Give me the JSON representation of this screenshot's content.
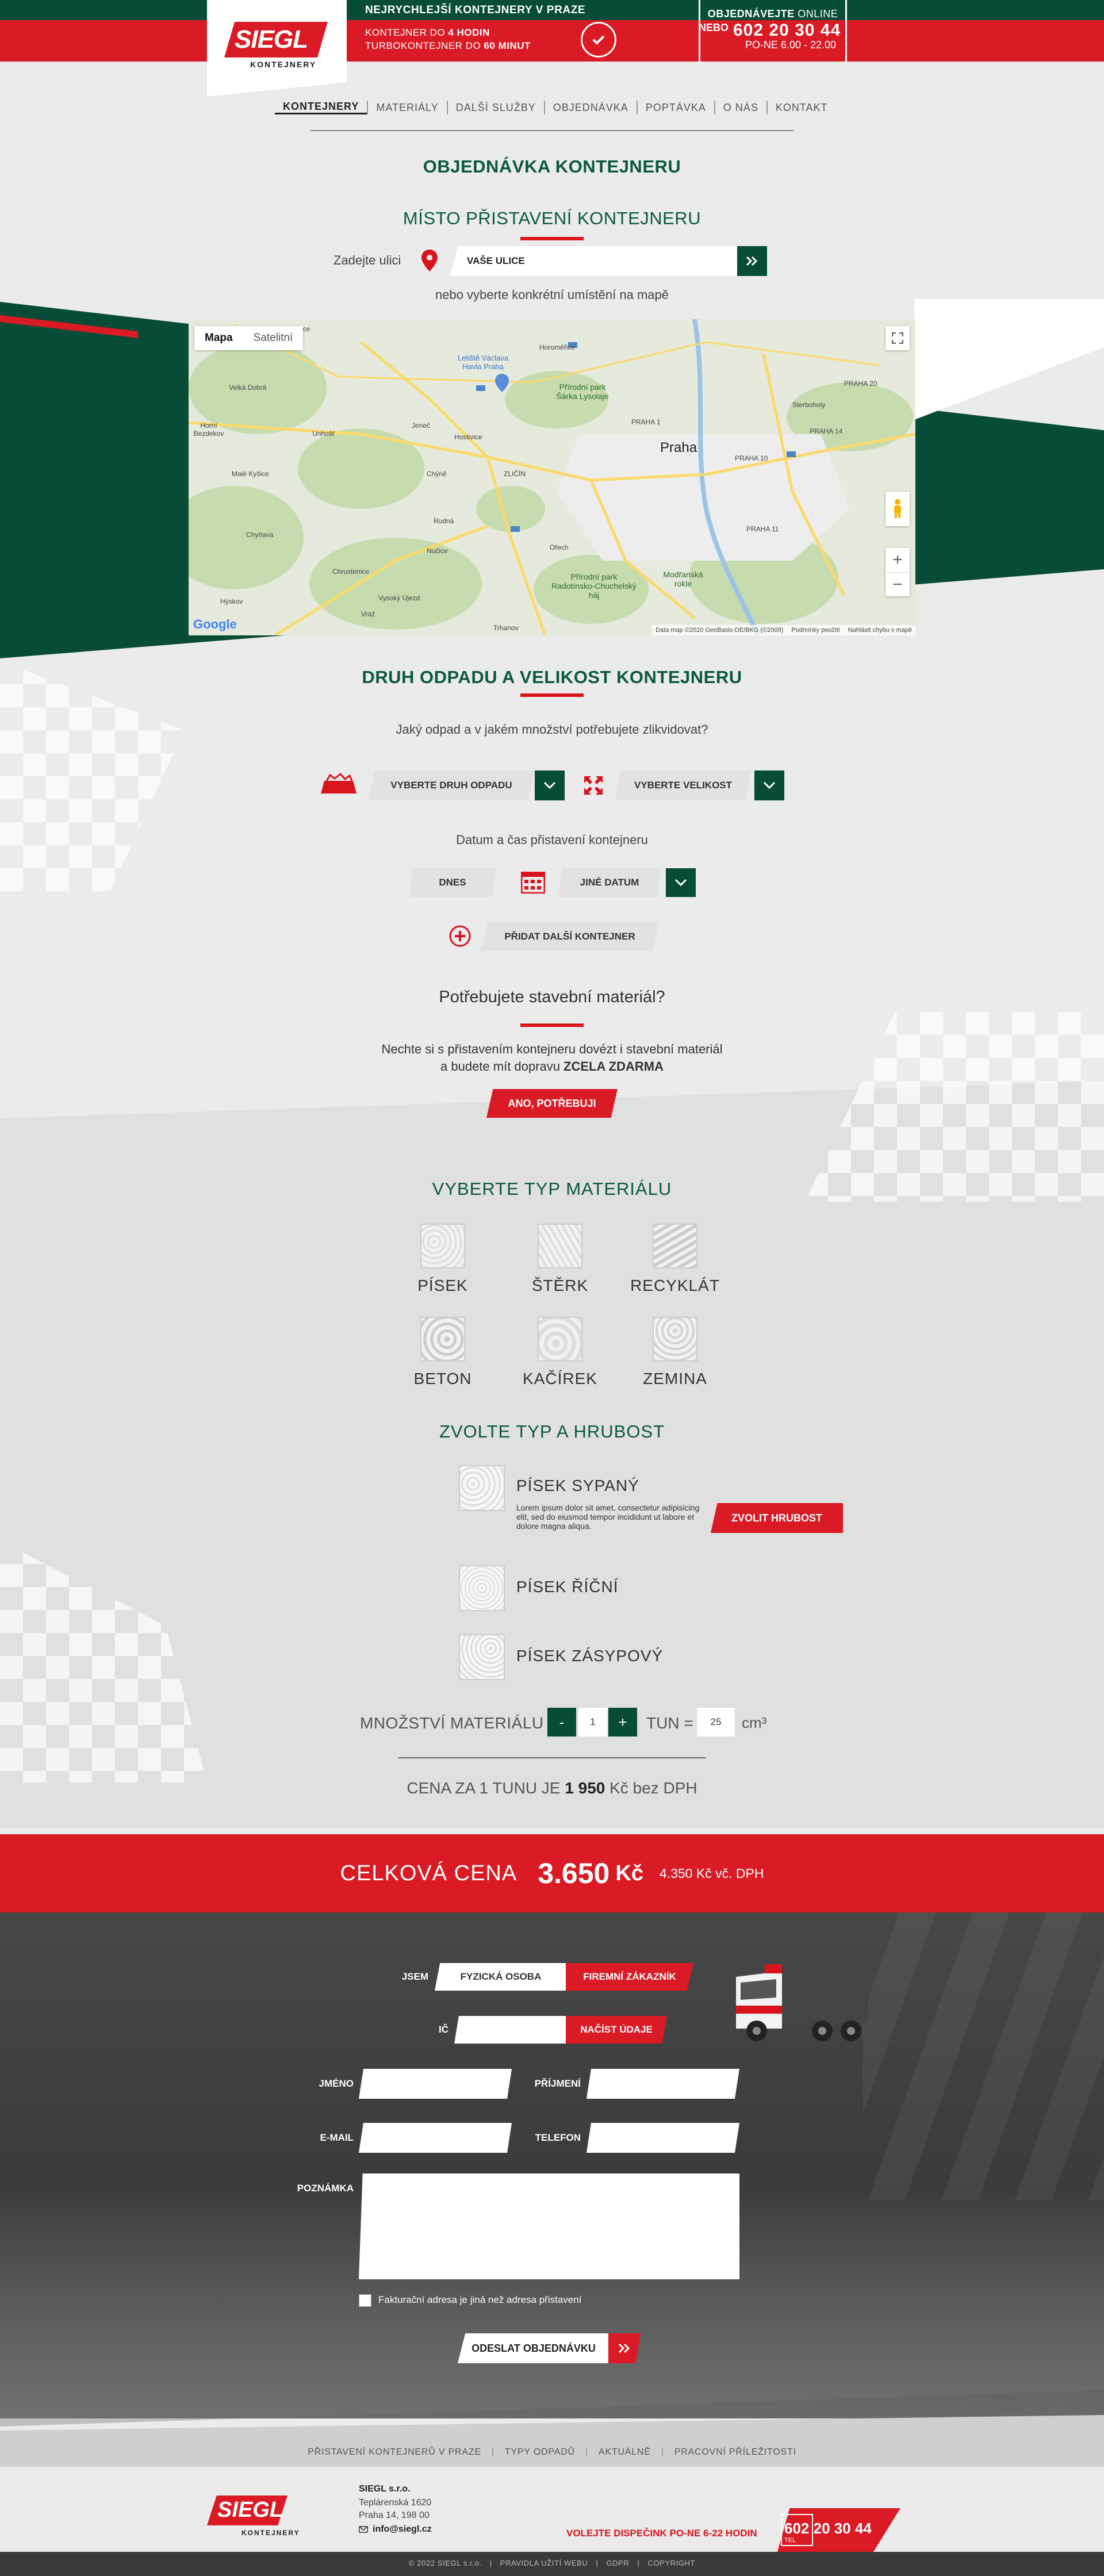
{
  "header": {
    "tagline": "NEJRYCHLEJŠÍ KONTEJNERY V PRAZE",
    "promo_line1_a": "KONTEJNER DO ",
    "promo_line1_b": "4 HODIN",
    "promo_line2_a": "TURBOKONTEJNER DO ",
    "promo_line2_b": "60 MINUT",
    "order_online_a": "OBJEDNÁVEJTE",
    "order_online_b": " ONLINE",
    "or": "NEBO",
    "phone": "602 20 30 44",
    "hours": "PO-NE 6.00 - 22.00",
    "logo_text": "SIEGL",
    "logo_sub": "KONTEJNERY"
  },
  "nav": {
    "items": [
      "KONTEJNERY",
      "MATERIÁLY",
      "DALŠÍ SLUŽBY",
      "OBJEDNÁVKA",
      "POPTÁVKA",
      "O NÁS",
      "KONTAKT"
    ]
  },
  "order": {
    "title": "OBJEDNÁVKA KONTEJNERU",
    "place_title": "MÍSTO PŘISTAVENÍ KONTEJNERU",
    "street_label": "Zadejte ulici",
    "street_placeholder": "VAŠE ULICE",
    "map_hint": "nebo vyberte konkrétní umístění na mapě"
  },
  "map": {
    "tab_map": "Mapa",
    "tab_sat": "Satelitní",
    "places": [
      "Lidice",
      "Velká Dobrá",
      "Horní Bezdekov",
      "Malé Kyšice",
      "Chyňava",
      "Unhošť",
      "Jeneč",
      "Hostivice",
      "Chýně",
      "Rudná",
      "Nučice",
      "Chrustenice",
      "Vysoký Újezd",
      "Vráž",
      "Hýskov",
      "Letiště Václava Havla Praha",
      "Horoměřice",
      "Přírodní park Šárka Lysolaje",
      "Praha",
      "PRAHA 1",
      "ZLIČÍN",
      "Ořech",
      "Přírodní park Radotínsko-Chuchelský háj",
      "Modřanská rokle",
      "Sterboholy",
      "PRAHA 20",
      "PRAHA 14",
      "PRAHA 10",
      "PRAHA 11",
      "Trhanov"
    ],
    "copyright": "Data map ©2020 GeoBasis-DE/BKG (©2009)",
    "terms": "Podmínky použití",
    "report": "Nahlásit chybu v mapě",
    "google": "Google"
  },
  "waste": {
    "title": "DRUH ODPADU A VELIKOST KONTEJNERU",
    "question": "Jaký odpad a v jakém množství potřebujete zlikvidovat?",
    "type_btn": "VYBERTE DRUH ODPADU",
    "size_btn": "VYBERTE VELIKOST",
    "date_label": "Datum a čas přistavení kontejneru",
    "today_btn": "DNES",
    "other_date_btn": "JINÉ DATUM",
    "add_btn": "PŘIDAT DALŠÍ KONTEJNER"
  },
  "material_offer": {
    "title": "Potřebujete stavební materiál?",
    "text1": "Nechte si s přistavením kontejneru dovézt i stavební materiál",
    "text2": "a budete mít dopravu ",
    "text2_b": "ZCELA ZDARMA",
    "yes_btn": "ANO, POTŘEBUJI"
  },
  "materials": {
    "title": "VYBERTE TYP MATERIÁLU",
    "items": [
      "PÍSEK",
      "ŠTĚRK",
      "RECYKLÁT",
      "BETON",
      "KAČÍREK",
      "ZEMINA"
    ]
  },
  "grain": {
    "title": "ZVOLTE TYP A HRUBOST",
    "items": [
      {
        "name": "PÍSEK SYPANÝ",
        "desc": "Lorem ipsum dolor sit amet, consectetur adipisicing elit, sed do eiusmod tempor incididunt ut labore et dolore magna aliqua."
      },
      {
        "name": "PÍSEK ŘÍČNÍ",
        "desc": ""
      },
      {
        "name": "PÍSEK ZÁSYPOVÝ",
        "desc": ""
      }
    ],
    "choose_btn": "ZVOLIT HRUBOST"
  },
  "quantity": {
    "label": "MNOŽSTVÍ MATERIÁLU",
    "minus": "-",
    "value": "1",
    "plus": "+",
    "unit_a": "TUN =",
    "volume": "25",
    "unit_b": "cm³",
    "price_a": "CENA ZA 1 TUNU JE ",
    "price_b": "1 950",
    "price_c": " Kč bez DPH"
  },
  "total": {
    "label": "CELKOVÁ CENA",
    "amount": "3.650",
    "currency": "Kč",
    "vat": "4.350 Kč vč. DPH"
  },
  "form": {
    "jsem": "JSEM",
    "person": "FYZICKÁ OSOBA",
    "company": "FIREMNÍ ZÁKAZNÍK",
    "ic": "IČ",
    "load_btn": "NAČÍST ÚDAJE",
    "name": "JMÉNO",
    "surname": "PŘÍJMENÍ",
    "email": "E-MAIL",
    "phone": "TELEFON",
    "note": "POZNÁMKA",
    "billing": "Fakturační adresa je jiná než adresa přistavení",
    "submit": "ODESLAT OBJEDNÁVKU"
  },
  "footer": {
    "links": [
      "PŘISTAVENÍ KONTEJNERŮ V PRAZE",
      "TYPY ODPADŮ",
      "AKTUÁLNĚ",
      "PRACOVNÍ PŘÍLEŽITOSTI"
    ],
    "company": "SIEGL s.r.o.",
    "street": "Teplárenská 1620",
    "city": "Praha 14, 198 00",
    "email": "info@siegl.cz",
    "dispatch": "VOLEJTE DISPEČINK PO-NE 6-22 HODIN",
    "phone": "602 20 30 44",
    "phone_prefix": "TEL",
    "bottom": [
      "© 2022 SIEGL s.r.o.",
      "PRAVIDLA UŽITÍ WEBU",
      "GDPR",
      "COPYRIGHT"
    ]
  },
  "colors": {
    "green": "#064c36",
    "red": "#da1a24",
    "grey": "#ebebeb",
    "dark": "#3d3d3d"
  }
}
